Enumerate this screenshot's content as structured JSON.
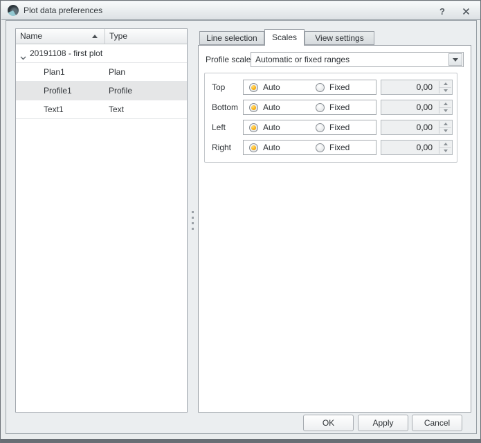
{
  "window": {
    "title": "Plot data preferences",
    "help_glyph": "?"
  },
  "tree": {
    "header": {
      "name": "Name",
      "type": "Type"
    },
    "sort": {
      "column": "Name",
      "direction": "ascending"
    },
    "rows": [
      {
        "name": "20191108 - first plot",
        "type": "",
        "level": 0,
        "expanded": true
      },
      {
        "name": "Plan1",
        "type": "Plan",
        "level": 1
      },
      {
        "name": "Profile1",
        "type": "Profile",
        "level": 1,
        "selected": true
      },
      {
        "name": "Text1",
        "type": "Text",
        "level": 1
      }
    ],
    "selected_row": "Profile1"
  },
  "tabs": [
    {
      "label": "Line selection",
      "active": false
    },
    {
      "label": "Scales",
      "active": true
    },
    {
      "label": "View settings",
      "active": false
    }
  ],
  "scales_tab": {
    "profile_scales": {
      "label": "Profile scales",
      "value": "Automatic or fixed ranges"
    },
    "rows": [
      {
        "label": "Top",
        "auto_label": "Auto",
        "fixed_label": "Fixed",
        "selected": "auto",
        "value": "0,00",
        "value_enabled": false
      },
      {
        "label": "Bottom",
        "auto_label": "Auto",
        "fixed_label": "Fixed",
        "selected": "auto",
        "value": "0,00",
        "value_enabled": false
      },
      {
        "label": "Left",
        "auto_label": "Auto",
        "fixed_label": "Fixed",
        "selected": "auto",
        "value": "0,00",
        "value_enabled": false
      },
      {
        "label": "Right",
        "auto_label": "Auto",
        "fixed_label": "Fixed",
        "selected": "auto",
        "value": "0,00",
        "value_enabled": false
      }
    ]
  },
  "footer_buttons": [
    {
      "label": "OK"
    },
    {
      "label": "Apply"
    },
    {
      "label": "Cancel"
    }
  ],
  "colors": {
    "radio_selected": "#f7a800",
    "row_selected": "#e5e6e7",
    "control_border": "#a6abb0",
    "panel_border": "#9aa0a6",
    "dialog_bg": "#ebeef0"
  }
}
